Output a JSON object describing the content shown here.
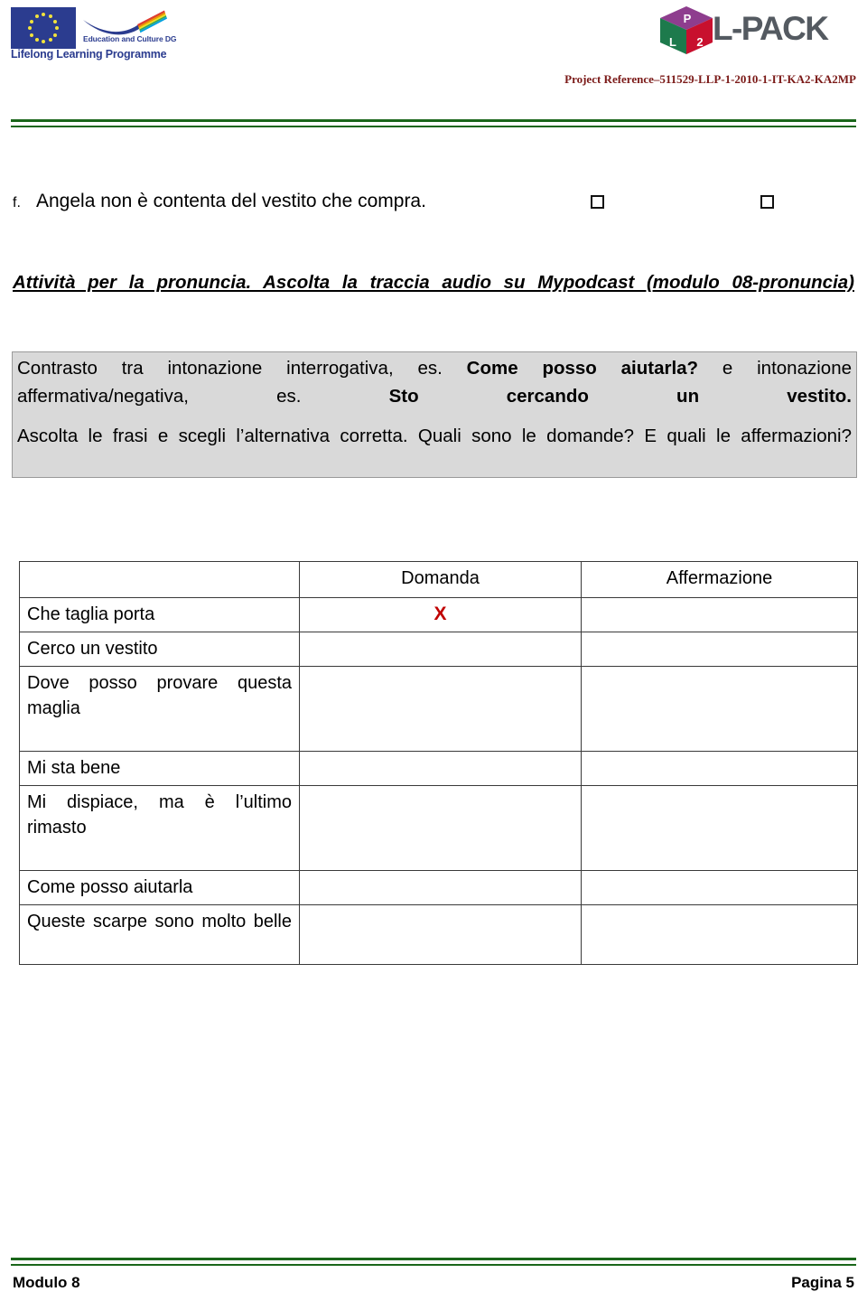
{
  "header": {
    "eu_logo": {
      "dg_label": "Education and Culture DG",
      "programme_label": "Lifelong Learning Programme"
    },
    "lpack_logo": {
      "wordmark": "L-PACK",
      "cube_top_letter": "P",
      "cube_left_letter": "L",
      "cube_right_letter": "2"
    },
    "project_reference": "Project Reference–511529-LLP-1-2010-1-IT-KA2-KA2MP"
  },
  "content": {
    "question_item": {
      "marker": "f.",
      "text": "Angela non è contenta del vestito che compra."
    },
    "activity_heading": "Attività per la pronuncia. Ascolta la traccia audio su Mypodcast (modulo 08-pronuncia)",
    "grey_box": {
      "paragraph_1": {
        "part_1": "Contrasto tra intonazione interrogativa, es. ",
        "bold_1": "Come posso aiutarla?",
        "part_2": " e intonazione affermativa/negativa, es. ",
        "bold_2": "Sto cercando un vestito."
      },
      "paragraph_2": "Ascolta le frasi e scegli l’alternativa corretta. Quali sono le domande? E quali le affermazioni?"
    },
    "table": {
      "headers": [
        "",
        "Domanda",
        "Affermazione"
      ],
      "rows": [
        {
          "phrase": "Che taglia porta",
          "domanda": "X",
          "affermazione": ""
        },
        {
          "phrase": "Cerco un vestito",
          "domanda": "",
          "affermazione": ""
        },
        {
          "phrase": "Dove posso provare questa maglia",
          "domanda": "",
          "affermazione": ""
        },
        {
          "phrase": "Mi sta bene",
          "domanda": "",
          "affermazione": ""
        },
        {
          "phrase": "Mi dispiace, ma è l’ultimo rimasto",
          "domanda": "",
          "affermazione": ""
        },
        {
          "phrase": "Come posso aiutarla",
          "domanda": "",
          "affermazione": ""
        },
        {
          "phrase": "Queste scarpe sono molto belle",
          "domanda": "",
          "affermazione": ""
        }
      ]
    }
  },
  "footer": {
    "left": "Modulo 8",
    "right": "Pagina 5"
  },
  "colors": {
    "rule_green": "#1a661a",
    "project_ref_red": "#7b1a18",
    "mark_red": "#c00000",
    "grey_box_bg": "#d9d9d9",
    "eu_blue": "#2b3c8f",
    "lpack_grey": "#545a61",
    "cube_purple": "#8e3d8e",
    "cube_green": "#1d7a4c",
    "cube_red": "#c8102e"
  }
}
